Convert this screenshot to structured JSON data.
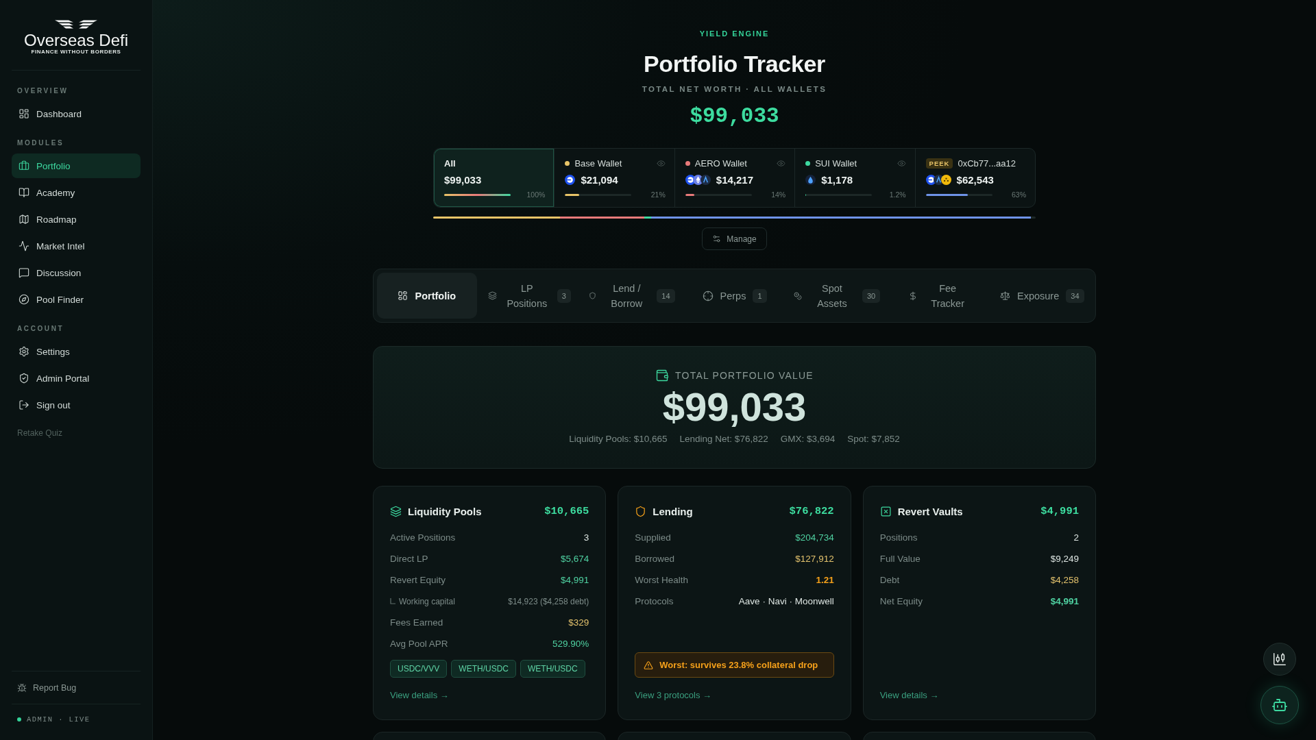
{
  "sidebar": {
    "logo": {
      "name": "Overseas Defi",
      "tagline": "FINANCE WITHOUT BORDERS"
    },
    "sections": [
      {
        "label": "OVERVIEW",
        "items": [
          {
            "label": "Dashboard",
            "selected": false
          }
        ]
      },
      {
        "label": "MODULES",
        "items": [
          {
            "label": "Portfolio",
            "selected": true
          },
          {
            "label": "Academy",
            "selected": false
          },
          {
            "label": "Roadmap",
            "selected": false
          },
          {
            "label": "Market Intel",
            "selected": false
          },
          {
            "label": "Discussion",
            "selected": false
          },
          {
            "label": "Pool Finder",
            "selected": false
          }
        ]
      },
      {
        "label": "ACCOUNT",
        "items": [
          {
            "label": "Settings",
            "selected": false
          },
          {
            "label": "Admin Portal",
            "selected": false
          },
          {
            "label": "Sign out",
            "selected": false
          }
        ]
      }
    ],
    "retake_link": "Retake Quiz",
    "report_bug": "Report Bug",
    "status": "ADMIN · LIVE"
  },
  "header": {
    "eyebrow": "YIELD ENGINE",
    "title": "Portfolio Tracker",
    "subtitle": "TOTAL NET WORTH · ALL WALLETS",
    "net_worth": "$99,033"
  },
  "wallets": [
    {
      "kind": "all",
      "name": "All",
      "value": "$99,033",
      "percent": "100%",
      "selected": true
    },
    {
      "kind": "wallet",
      "name": "Base Wallet",
      "color": "#e8c468",
      "tokens": [
        {
          "kind": "base"
        }
      ],
      "value": "$21,094",
      "percent": "21%",
      "level": 0.21,
      "selected": false
    },
    {
      "kind": "wallet",
      "name": "AERO Wallet",
      "color": "#e87a7a",
      "tokens": [
        {
          "kind": "base"
        },
        {
          "kind": "eth"
        },
        {
          "kind": "arb"
        }
      ],
      "value": "$14,217",
      "percent": "14%",
      "level": 0.14,
      "selected": false
    },
    {
      "kind": "wallet",
      "name": "SUI Wallet",
      "color": "#3dd9a0",
      "tokens": [
        {
          "kind": "sui"
        }
      ],
      "value": "$1,178",
      "percent": "1.2%",
      "level": 0.012,
      "selected": false
    },
    {
      "kind": "watch",
      "badge": "PEEK",
      "name": "0xCb77...aa12",
      "color": "#6f93e8",
      "tokens": [
        {
          "kind": "base"
        },
        {
          "kind": "arb"
        },
        {
          "kind": "bnb"
        }
      ],
      "value": "$62,543",
      "percent": "63%",
      "level": 0.63,
      "selected": false
    }
  ],
  "manage_button": "Manage",
  "tabs": [
    {
      "label": "Portfolio",
      "selected": true
    },
    {
      "label": "LP Positions",
      "count": "3",
      "selected": false
    },
    {
      "label": "Lend / Borrow",
      "count": "14",
      "selected": false
    },
    {
      "label": "Perps",
      "count": "1",
      "selected": false
    },
    {
      "label": "Spot Assets",
      "count": "30",
      "selected": false
    },
    {
      "label": "Fee Tracker",
      "selected": false
    },
    {
      "label": "Exposure",
      "count": "34",
      "selected": false
    }
  ],
  "total": {
    "label": "TOTAL PORTFOLIO VALUE",
    "value": "$99,033",
    "breakdown": [
      "Liquidity Pools: $10,665",
      "Lending Net: $76,822",
      "GMX: $3,694",
      "Spot: $7,852"
    ]
  },
  "cards": [
    {
      "title": "Liquidity Pools",
      "total": "$10,665",
      "rows": [
        {
          "kind": "row",
          "label": "Active Positions",
          "value": "3",
          "color": "#dde5e2",
          "strong": false
        },
        {
          "kind": "row",
          "label": "Direct LP",
          "value": "$5,674",
          "color": "#4fd1a1",
          "strong": false
        },
        {
          "kind": "row",
          "label": "Revert Equity",
          "value": "$4,991",
          "color": "#4fd1a1",
          "strong": false
        },
        {
          "kind": "sub",
          "label": "Working capital",
          "value": "$14,923 ($4,258 debt)",
          "color": "#7c8b88",
          "strong": false
        },
        {
          "kind": "row",
          "label": "Fees Earned",
          "value": "$329",
          "color": "#e3c26d",
          "strong": false
        },
        {
          "kind": "row",
          "label": "Avg Pool APR",
          "value": "529.90%",
          "color": "#4fd1a1",
          "strong": false
        }
      ],
      "tags": [
        "USDC/VVV",
        "WETH/USDC",
        "WETH/USDC"
      ],
      "link": "View details →"
    },
    {
      "title": "Lending",
      "total": "$76,822",
      "rows": [
        {
          "kind": "row",
          "label": "Supplied",
          "value": "$204,734",
          "color": "#4fd1a1",
          "strong": false
        },
        {
          "kind": "row",
          "label": "Borrowed",
          "value": "$127,912",
          "color": "#e3c26d",
          "strong": false
        },
        {
          "kind": "row",
          "label": "Worst Health",
          "value": "1.21",
          "color": "#f5a01a",
          "strong": true
        },
        {
          "kind": "row",
          "label": "Protocols",
          "value": "Aave · Navi · Moonwell",
          "color": "#dde5e2",
          "strong": false
        }
      ],
      "alert": "Worst: survives 23.8% collateral drop",
      "link": "View 3 protocols →"
    },
    {
      "title": "Revert Vaults",
      "total": "$4,991",
      "rows": [
        {
          "kind": "row",
          "label": "Positions",
          "value": "2",
          "color": "#dde5e2",
          "strong": false
        },
        {
          "kind": "row",
          "label": "Full Value",
          "value": "$9,249",
          "color": "#dde5e2",
          "strong": false
        },
        {
          "kind": "row",
          "label": "Debt",
          "value": "$4,258",
          "color": "#e3c26d",
          "strong": false
        },
        {
          "kind": "row",
          "label": "Net Equity",
          "value": "$4,991",
          "color": "#4fd1a1",
          "strong": true
        }
      ],
      "link": "View details →"
    }
  ]
}
